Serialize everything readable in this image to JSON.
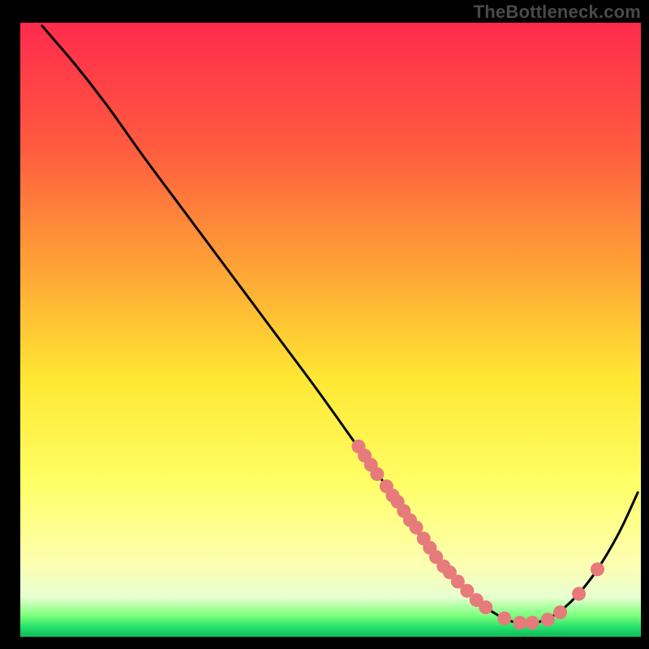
{
  "watermark": "TheBottleneck.com",
  "chart_data": {
    "type": "line",
    "title": "",
    "xlabel": "",
    "ylabel": "",
    "xlim": [
      0,
      100
    ],
    "ylim": [
      0,
      100
    ],
    "background_gradient": {
      "stops": [
        {
          "offset": 0.0,
          "color": "#ff2b4d"
        },
        {
          "offset": 0.2,
          "color": "#ff5a3f"
        },
        {
          "offset": 0.4,
          "color": "#ffa336"
        },
        {
          "offset": 0.58,
          "color": "#ffe733"
        },
        {
          "offset": 0.75,
          "color": "#ffff66"
        },
        {
          "offset": 0.88,
          "color": "#fcffb0"
        },
        {
          "offset": 0.935,
          "color": "#e8ffd0"
        },
        {
          "offset": 0.965,
          "color": "#7dff7d"
        },
        {
          "offset": 0.985,
          "color": "#22e06a"
        },
        {
          "offset": 1.0,
          "color": "#0fb85a"
        }
      ]
    },
    "series": [
      {
        "name": "bottleneck-curve",
        "type": "line",
        "x": [
          3.5,
          9.0,
          14.0,
          20.0,
          27.0,
          34.0,
          41.0,
          48.0,
          54.0,
          59.0,
          63.0,
          66.5,
          70.0,
          73.5,
          77.0,
          80.0,
          83.0,
          86.0,
          89.5,
          93.0,
          96.5,
          99.5
        ],
        "y": [
          99.5,
          93.0,
          86.5,
          78.0,
          68.5,
          59.0,
          49.5,
          40.0,
          31.5,
          24.5,
          18.5,
          13.5,
          9.5,
          6.0,
          3.5,
          2.3,
          2.3,
          3.5,
          6.5,
          11.0,
          17.0,
          23.5
        ]
      },
      {
        "name": "highlight-dots",
        "type": "scatter",
        "x": [
          54.5,
          55.5,
          56.5,
          57.5,
          59.0,
          60.0,
          60.8,
          61.8,
          62.8,
          63.8,
          65.0,
          66.0,
          67.0,
          68.2,
          69.2,
          70.5,
          72.0,
          73.5,
          75.0,
          78.0,
          80.5,
          82.5,
          85.0,
          87.0,
          90.0,
          93.0
        ],
        "y": [
          31.0,
          29.5,
          28.0,
          26.5,
          24.5,
          23.0,
          22.0,
          20.5,
          19.0,
          17.8,
          16.0,
          14.5,
          13.0,
          11.5,
          10.5,
          9.0,
          7.5,
          6.0,
          4.8,
          3.0,
          2.3,
          2.3,
          2.8,
          4.0,
          7.0,
          11.0
        ]
      }
    ]
  }
}
